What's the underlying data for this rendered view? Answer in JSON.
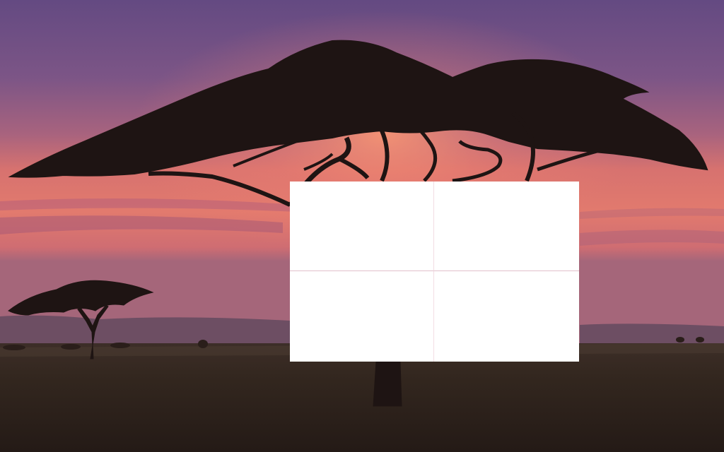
{
  "wallpaper": {
    "scene": "savanna-sunset",
    "colors": {
      "sky_top": "#6b4d86",
      "sky_mid": "#a2627f",
      "horizon_glow": "#e9796f",
      "horizon_band": "#d9726f",
      "hills": "#6a4e63",
      "ground": "#2f2420",
      "silhouette": "#1e1413"
    }
  },
  "tile_panel": {
    "tile_color": "#ffffff",
    "tiles": [
      {
        "id": "top-left",
        "text": ""
      },
      {
        "id": "top-right",
        "text": ""
      },
      {
        "id": "bottom-left",
        "text": ""
      },
      {
        "id": "bottom-right",
        "text": ""
      }
    ]
  }
}
